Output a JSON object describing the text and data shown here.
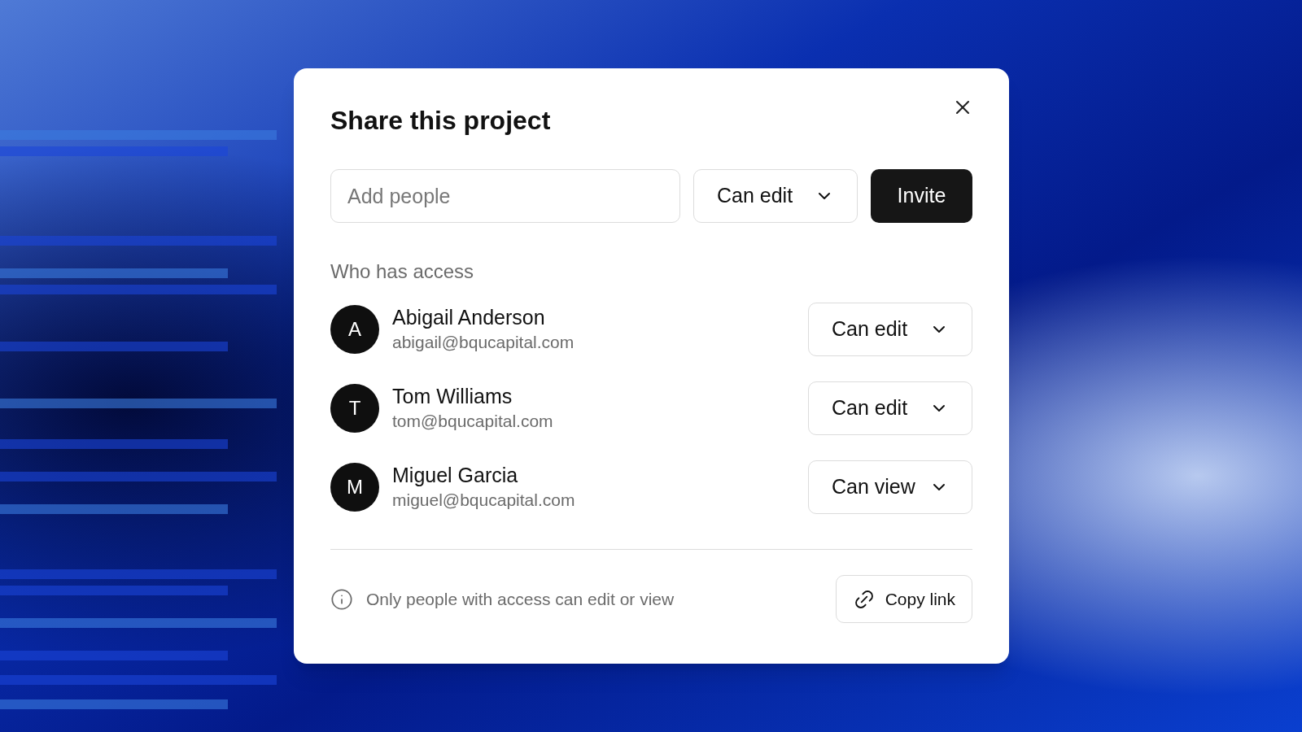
{
  "dialog": {
    "title": "Share this project",
    "invite": {
      "placeholder": "Add people",
      "role": "Can edit",
      "button": "Invite"
    },
    "section_label": "Who has access",
    "people": [
      {
        "initial": "A",
        "name": "Abigail Anderson",
        "email": "abigail@bqucapital.com",
        "role": "Can edit"
      },
      {
        "initial": "T",
        "name": "Tom Williams",
        "email": "tom@bqucapital.com",
        "role": "Can edit"
      },
      {
        "initial": "M",
        "name": "Miguel Garcia",
        "email": "miguel@bqucapital.com",
        "role": "Can view"
      }
    ],
    "footer": {
      "note": "Only people with access can edit or view",
      "copy_button": "Copy link"
    }
  }
}
